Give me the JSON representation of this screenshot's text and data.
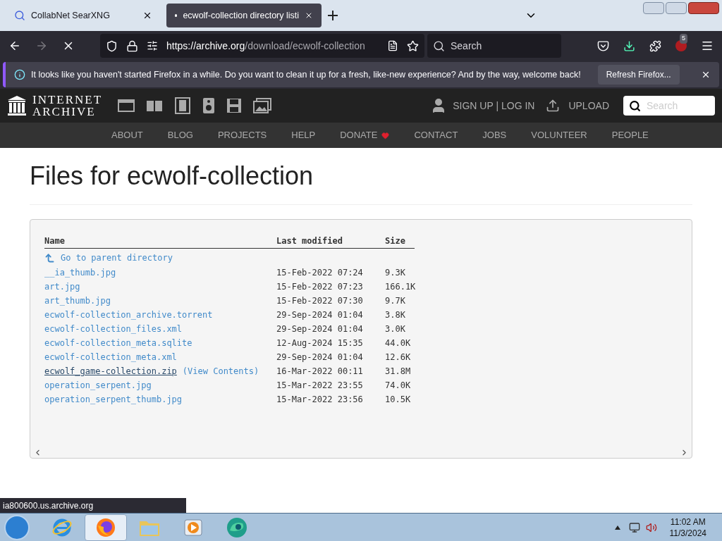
{
  "browser": {
    "tabs": [
      {
        "title": "CollabNet SearXNG",
        "selected": false
      },
      {
        "title": "ecwolf-collection directory listi",
        "selected": true
      }
    ],
    "url_host": "https://archive.org",
    "url_path": "/download/ecwolf-collection",
    "search_placeholder": "Search",
    "extension_badge": "5",
    "notification": {
      "text": "It looks like you haven't started Firefox in a while. Do you want to clean it up for a fresh, like-new experience? And by the way, welcome back!",
      "button": "Refresh Firefox..."
    }
  },
  "site": {
    "logo_lines": [
      "INTERNET",
      "ARCHIVE"
    ],
    "account": "SIGN UP | LOG IN",
    "upload": "UPLOAD",
    "search_placeholder": "Search",
    "nav": [
      {
        "label": "ABOUT",
        "kind": "plain"
      },
      {
        "label": "BLOG",
        "kind": "plain"
      },
      {
        "label": "PROJECTS",
        "kind": "plain"
      },
      {
        "label": "HELP",
        "kind": "plain"
      },
      {
        "label": "DONATE",
        "kind": "heart"
      },
      {
        "label": "CONTACT",
        "kind": "plain"
      },
      {
        "label": "JOBS",
        "kind": "plain"
      },
      {
        "label": "VOLUNTEER",
        "kind": "plain"
      },
      {
        "label": "PEOPLE",
        "kind": "plain"
      }
    ]
  },
  "heading": "Files for ecwolf-collection",
  "table": {
    "columns": [
      "Name",
      "Last modified",
      "Size"
    ],
    "parent_link": "Go to parent directory",
    "rows": [
      {
        "name": "__ia_thumb.jpg",
        "modified": "15-Feb-2022 07:24",
        "size": "9.3K",
        "hovered": false
      },
      {
        "name": "art.jpg",
        "modified": "15-Feb-2022 07:23",
        "size": "166.1K",
        "hovered": false
      },
      {
        "name": "art_thumb.jpg",
        "modified": "15-Feb-2022 07:30",
        "size": "9.7K",
        "hovered": false
      },
      {
        "name": "ecwolf-collection_archive.torrent",
        "modified": "29-Sep-2024 01:04",
        "size": "3.8K",
        "hovered": false
      },
      {
        "name": "ecwolf-collection_files.xml",
        "modified": "29-Sep-2024 01:04",
        "size": "3.0K",
        "hovered": false
      },
      {
        "name": "ecwolf-collection_meta.sqlite",
        "modified": "12-Aug-2024 15:35",
        "size": "44.0K",
        "hovered": false
      },
      {
        "name": "ecwolf-collection_meta.xml",
        "modified": "29-Sep-2024 01:04",
        "size": "12.6K",
        "hovered": false
      },
      {
        "name": "ecwolf_game-collection.zip",
        "extra": "(View Contents)",
        "modified": "16-Mar-2022 00:11",
        "size": "31.8M",
        "hovered": true
      },
      {
        "name": "operation_serpent.jpg",
        "modified": "15-Mar-2022 23:55",
        "size": "74.0K",
        "hovered": false
      },
      {
        "name": "operation_serpent_thumb.jpg",
        "modified": "15-Mar-2022 23:56",
        "size": "10.5K",
        "hovered": false
      }
    ]
  },
  "status_url": "ia800600.us.archive.org",
  "taskbar": {
    "apps": [
      {
        "kind": "ie",
        "selected": false
      },
      {
        "kind": "firefox",
        "selected": true
      },
      {
        "kind": "folder",
        "selected": false
      },
      {
        "kind": "media",
        "selected": false
      },
      {
        "kind": "edge",
        "selected": false
      }
    ],
    "time": "11:02 AM",
    "date": "11/3/2024"
  }
}
